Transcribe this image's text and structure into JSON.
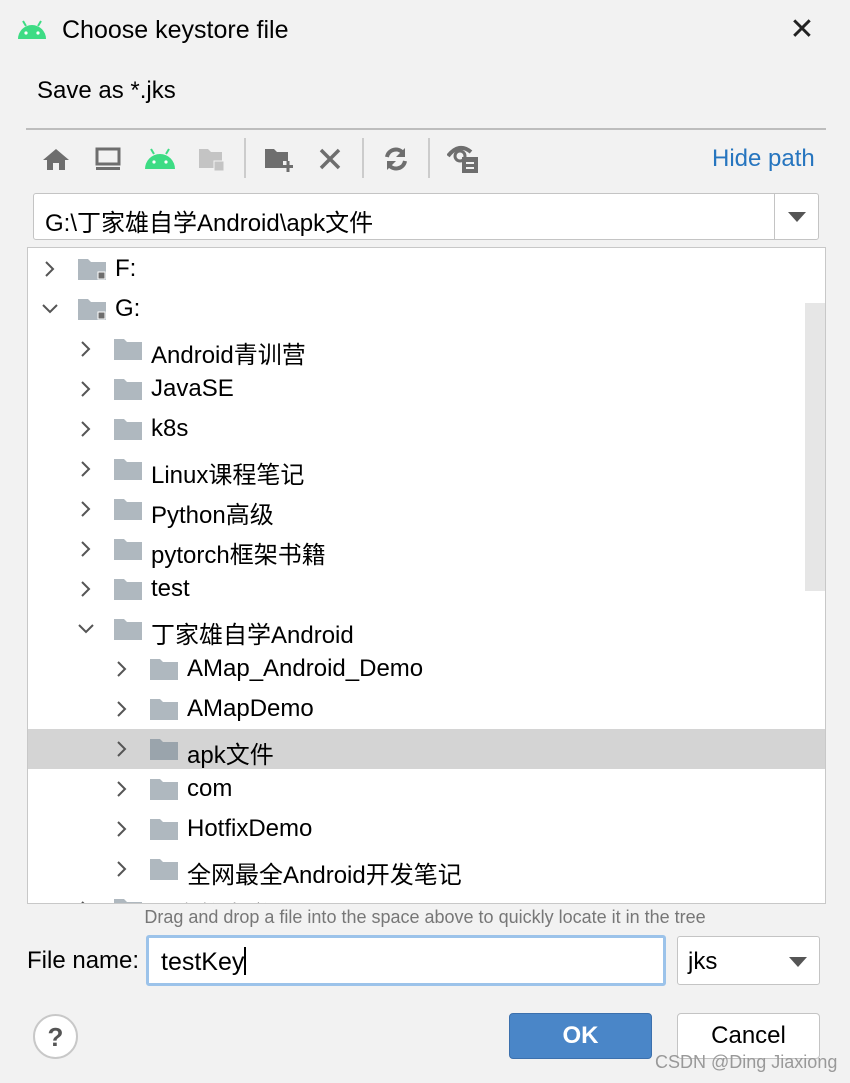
{
  "dialog": {
    "title": "Choose keystore file",
    "subtitle": "Save as *.jks",
    "close_icon": "close-icon"
  },
  "toolbar": {
    "icons": [
      "home-icon",
      "desktop-icon",
      "android-project-icon",
      "module-folder-icon",
      "new-folder-icon",
      "delete-icon",
      "refresh-icon",
      "show-hidden-icon"
    ],
    "hide_path": "Hide path",
    "android_color": "#3ddc84"
  },
  "path": {
    "value": "G:\\丁家雄自学Android\\apk文件"
  },
  "tree": {
    "rows": [
      {
        "label": "F:",
        "level": 0,
        "expanded": false,
        "drive": true
      },
      {
        "label": "G:",
        "level": 0,
        "expanded": true,
        "drive": true
      },
      {
        "label": "Android青训营",
        "level": 1,
        "expanded": false
      },
      {
        "label": "JavaSE",
        "level": 1,
        "expanded": false
      },
      {
        "label": "k8s",
        "level": 1,
        "expanded": false
      },
      {
        "label": "Linux课程笔记",
        "level": 1,
        "expanded": false
      },
      {
        "label": "Python高级",
        "level": 1,
        "expanded": false
      },
      {
        "label": "pytorch框架书籍",
        "level": 1,
        "expanded": false
      },
      {
        "label": "test",
        "level": 1,
        "expanded": false
      },
      {
        "label": "丁家雄自学Android",
        "level": 1,
        "expanded": true
      },
      {
        "label": "AMap_Android_Demo",
        "level": 2,
        "expanded": false
      },
      {
        "label": "AMapDemo",
        "level": 2,
        "expanded": false
      },
      {
        "label": "apk文件",
        "level": 2,
        "expanded": false,
        "selected": true
      },
      {
        "label": "com",
        "level": 2,
        "expanded": false
      },
      {
        "label": "HotfixDemo",
        "level": 2,
        "expanded": false
      },
      {
        "label": "全网最全Android开发笔记",
        "level": 2,
        "expanded": false
      },
      {
        "label": "丁家雄自学Di",
        "level": 1,
        "expanded": false
      }
    ]
  },
  "hint": "Drag and drop a file into the space above to quickly locate it in the tree",
  "file_name": {
    "label": "File name:",
    "value": "testKey"
  },
  "file_type": {
    "value": "jks"
  },
  "buttons": {
    "help": "?",
    "ok": "OK",
    "cancel": "Cancel"
  },
  "watermark": "CSDN @Ding Jiaxiong"
}
